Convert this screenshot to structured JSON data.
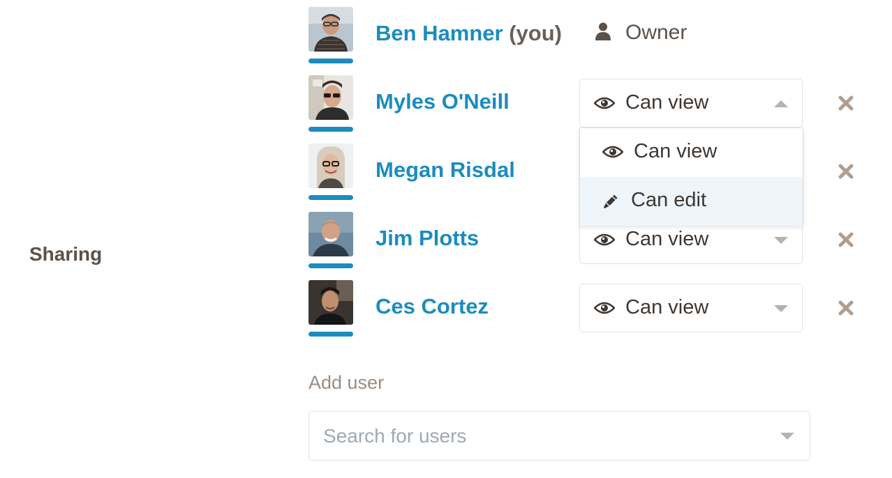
{
  "section": {
    "label": "Sharing"
  },
  "owner_row": {
    "name": "Ben Hamner",
    "you_tag": "(you)",
    "role_icon": "person-icon",
    "role": "Owner",
    "tier_color": "#1b8cbf"
  },
  "collaborators": [
    {
      "name": "Myles O'Neill",
      "permission": "Can view",
      "permission_icon": "eye-icon",
      "dropdown_open": true,
      "remove_icon": "close-icon"
    },
    {
      "name": "Megan Risdal",
      "permission": "",
      "permission_icon": "eye-icon",
      "dropdown_open": false,
      "remove_icon": "close-icon"
    },
    {
      "name": "Jim Plotts",
      "permission": "Can view",
      "permission_icon": "eye-icon",
      "dropdown_open": false,
      "remove_icon": "close-icon"
    },
    {
      "name": "Ces Cortez",
      "permission": "Can view",
      "permission_icon": "eye-icon",
      "dropdown_open": false,
      "remove_icon": "close-icon"
    }
  ],
  "permission_menu": {
    "options": [
      {
        "label": "Can view",
        "icon": "eye-icon",
        "highlighted": false
      },
      {
        "label": "Can edit",
        "icon": "pencil-icon",
        "highlighted": true
      }
    ]
  },
  "add_user": {
    "label": "Add user",
    "placeholder": "Search for users"
  },
  "colors": {
    "name_link": "#1b8cbf",
    "tier_bar": "#1b8cbf",
    "remove_icon": "#b19d8e",
    "highlight": "#eef5fb"
  }
}
